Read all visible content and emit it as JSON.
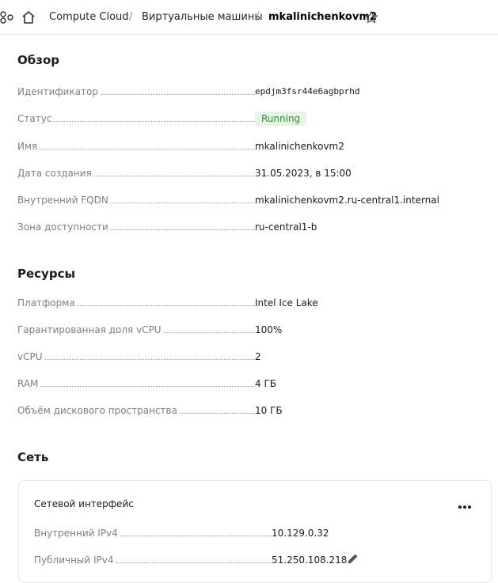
{
  "breadcrumb": {
    "items": [
      "Compute Cloud",
      "Виртуальные машины",
      "mkalinichenkovm2"
    ],
    "separator": "/"
  },
  "overview": {
    "title": "Обзор",
    "rows": [
      {
        "label": "Идентификатор",
        "value": "epdjm3fsr44e6agbprhd"
      },
      {
        "label": "Статус",
        "value": "Running"
      },
      {
        "label": "Имя",
        "value": "mkalinichenkovm2"
      },
      {
        "label": "Дата создания",
        "value": "31.05.2023, в 15:00"
      },
      {
        "label": "Внутренний FQDN",
        "value": "mkalinichenkovm2.ru-central1.internal"
      },
      {
        "label": "Зона доступности",
        "value": "ru-central1-b"
      }
    ]
  },
  "resources": {
    "title": "Ресурсы",
    "rows": [
      {
        "label": "Платформа",
        "value": "Intel Ice Lake"
      },
      {
        "label": "Гарантированная доля vCPU",
        "value": "100%"
      },
      {
        "label": "vCPU",
        "value": "2"
      },
      {
        "label": "RAM",
        "value": "4 ГБ"
      },
      {
        "label": "Объём дискового пространства",
        "value": "10 ГБ"
      }
    ]
  },
  "network": {
    "title": "Сеть",
    "interface": {
      "title": "Сетевой интерфейс",
      "rows": [
        {
          "label": "Внутренний IPv4",
          "value": "10.129.0.32"
        },
        {
          "label": "Публичный IPv4",
          "value": "51.250.108.218"
        }
      ]
    }
  },
  "colors": {
    "status_running_bg": "#e6f4e6",
    "status_running_text": "#2f8f2f",
    "label_text": "#7f7f7f"
  },
  "icons": [
    "nodes-icon",
    "home-icon",
    "star-icon",
    "more-icon",
    "pencil-icon"
  ]
}
